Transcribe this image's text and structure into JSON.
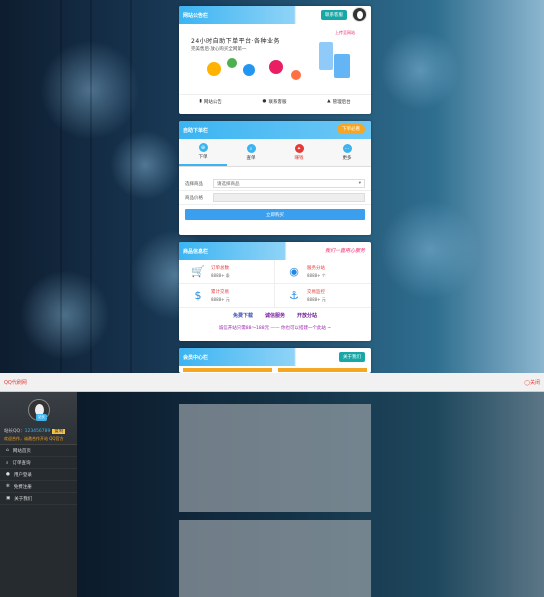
{
  "top_panel": {
    "title": "网站公告栏",
    "button": "联系客服",
    "slogan": "24小时自助下单平台·各种业务",
    "subslogan": "完美售后·放心购买全网第一",
    "banner_tag": "上传至网站",
    "links": [
      {
        "icon": "file-icon",
        "label": "网站公告"
      },
      {
        "icon": "bag-icon",
        "label": "联系客服"
      },
      {
        "icon": "user-icon",
        "label": "管理后台"
      }
    ]
  },
  "order_panel": {
    "title": "自助下单栏",
    "orange_button": "下单必看",
    "tabs": [
      {
        "icon": "cart-icon",
        "label": "下单"
      },
      {
        "icon": "search-icon",
        "label": "查单"
      },
      {
        "icon": "gift-icon",
        "label": "赚钱"
      },
      {
        "icon": "more-icon",
        "label": "更多"
      }
    ],
    "fields": [
      {
        "label": "选择商品",
        "value": "请选择商品"
      },
      {
        "label": "商品价格",
        "value": ""
      }
    ],
    "submit": "立即购买"
  },
  "stats_panel": {
    "title": "商品信息栏",
    "banner": "我们一直用心服务",
    "cells": [
      {
        "icon": "cart-icon",
        "title": "订单总数",
        "value": "8888+ 条"
      },
      {
        "icon": "qq-icon",
        "title": "服务分站",
        "value": "8888+ 个"
      },
      {
        "icon": "dollar-icon",
        "title": "累计交易",
        "value": "8888+ 元"
      },
      {
        "icon": "anchor-icon",
        "title": "交易监控",
        "value": "8888+ 元"
      }
    ],
    "tags": [
      "免费下载",
      "诚信服务",
      "开放分站"
    ],
    "marquee": "诚信开站只需88～188元 —— 你也可以搭建一个此站 ~"
  },
  "bottom_panel": {
    "title": "会员中心栏",
    "button": "关于我们"
  },
  "topbar": {
    "brand": "QQ代刷网",
    "close": "关闭"
  },
  "sidebar": {
    "badge": "站长",
    "qq_label": "站长QQ：",
    "qq_value": "123456789",
    "qq_tag": "复制",
    "cooperation": "欢迎合作，诚邀合作开站 QQ官方",
    "items": [
      {
        "icon": "home-icon",
        "label": "网站首页"
      },
      {
        "icon": "search-icon",
        "label": "订单查询"
      },
      {
        "icon": "user-icon",
        "label": "用户登录"
      },
      {
        "icon": "gear-icon",
        "label": "免费注册"
      },
      {
        "icon": "info-icon",
        "label": "关于我们"
      }
    ]
  }
}
